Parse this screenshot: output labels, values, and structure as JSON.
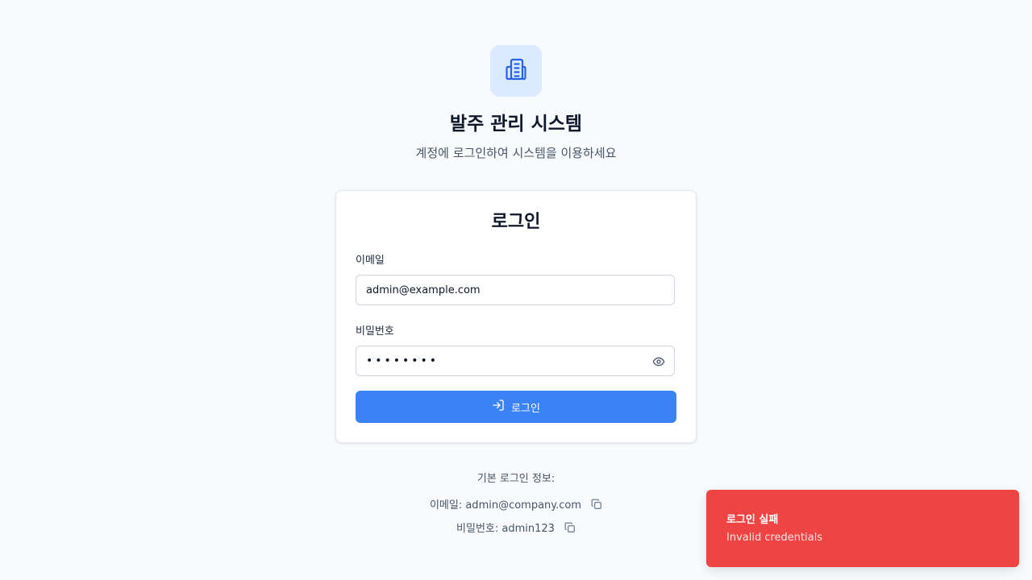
{
  "app": {
    "title": "발주 관리 시스템",
    "subtitle": "계정에 로그인하여 시스템을 이용하세요",
    "logo_icon": "building-icon"
  },
  "login_card": {
    "title": "로그인",
    "email_label": "이메일",
    "email_value": "admin@example.com",
    "password_label": "비밀번호",
    "password_value": "••••••••",
    "submit_label": "로그인",
    "submit_icon": "log-in-icon",
    "toggle_icon": "eye-icon"
  },
  "default_info": {
    "heading": "기본 로그인 정보:",
    "email_line": "이메일: admin@company.com",
    "password_line": "비밀번호: admin123",
    "copy_icon": "copy-icon"
  },
  "toast": {
    "title": "로그인 실패",
    "message": "Invalid credentials"
  },
  "colors": {
    "background": "#f8fafc",
    "primary": "#3b82f6",
    "logo_bg": "#dbeafe",
    "logo_icon": "#2563eb",
    "error": "#ef4444"
  }
}
